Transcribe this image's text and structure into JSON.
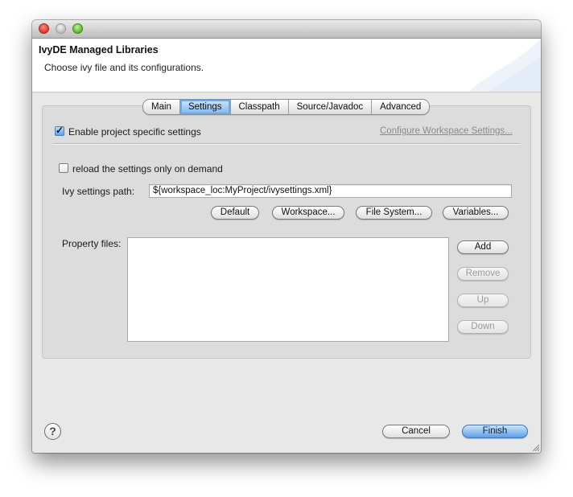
{
  "dialog": {
    "title": "IvyDE Managed Libraries",
    "subtitle": "Choose ivy file and its configurations."
  },
  "tabs": [
    {
      "label": "Main",
      "selected": false
    },
    {
      "label": "Settings",
      "selected": true
    },
    {
      "label": "Classpath",
      "selected": false
    },
    {
      "label": "Source/Javadoc",
      "selected": false
    },
    {
      "label": "Advanced",
      "selected": false
    }
  ],
  "settings": {
    "enable_project_specific": {
      "label": "Enable project specific settings",
      "checked": true
    },
    "configure_workspace_link": "Configure Workspace Settings...",
    "reload_on_demand": {
      "label": "reload the settings only on demand",
      "checked": false
    },
    "ivy_settings_path": {
      "label": "Ivy settings path:",
      "value": "${workspace_loc:MyProject/ivysettings.xml}"
    },
    "path_buttons": {
      "default": "Default",
      "workspace": "Workspace...",
      "file_system": "File System...",
      "variables": "Variables..."
    },
    "property_files": {
      "label": "Property files:",
      "items": [],
      "buttons": {
        "add": {
          "label": "Add",
          "enabled": true
        },
        "remove": {
          "label": "Remove",
          "enabled": false
        },
        "up": {
          "label": "Up",
          "enabled": false
        },
        "down": {
          "label": "Down",
          "enabled": false
        }
      }
    }
  },
  "footer": {
    "help_glyph": "?",
    "cancel": "Cancel",
    "finish": "Finish"
  },
  "colors": {
    "accent_blue": "#5b9fe6",
    "window_bg": "#e8e8e8",
    "panel_bg": "#dcdcdc",
    "traffic_close": "#d9362b",
    "traffic_zoom": "#57b52b"
  },
  "icons": {
    "close": "close-icon",
    "minimize": "minimize-icon",
    "zoom": "zoom-icon",
    "help": "help-icon",
    "checkmark": "checkmark-icon",
    "resize": "resize-grip-icon"
  }
}
